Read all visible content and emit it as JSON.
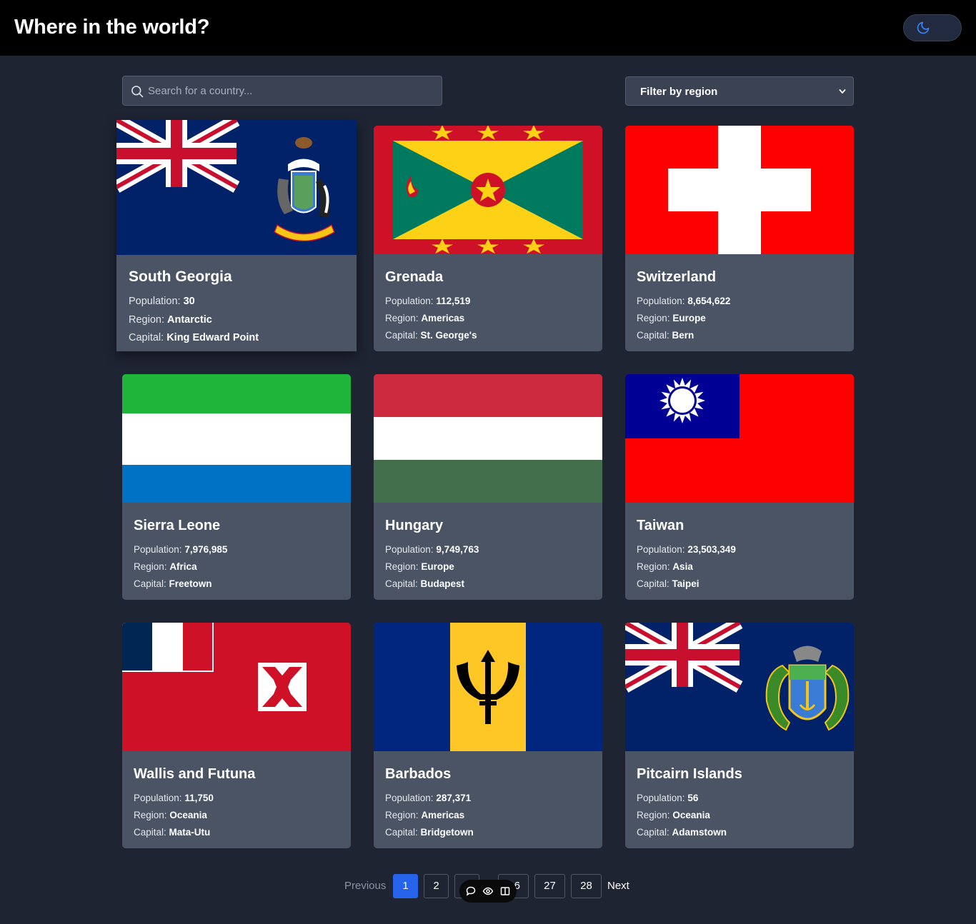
{
  "header": {
    "title": "Where in the world?",
    "theme_icon": "moon-icon"
  },
  "search": {
    "placeholder": "Search for a country..."
  },
  "filter": {
    "label": "Filter by region"
  },
  "labels": {
    "population": "Population:",
    "region": "Region:",
    "capital": "Capital:"
  },
  "countries": [
    {
      "name": "South Georgia",
      "population": "30",
      "region": "Antarctic",
      "capital": "King Edward Point"
    },
    {
      "name": "Grenada",
      "population": "112,519",
      "region": "Americas",
      "capital": "St. George's"
    },
    {
      "name": "Switzerland",
      "population": "8,654,622",
      "region": "Europe",
      "capital": "Bern"
    },
    {
      "name": "Sierra Leone",
      "population": "7,976,985",
      "region": "Africa",
      "capital": "Freetown"
    },
    {
      "name": "Hungary",
      "population": "9,749,763",
      "region": "Europe",
      "capital": "Budapest"
    },
    {
      "name": "Taiwan",
      "population": "23,503,349",
      "region": "Asia",
      "capital": "Taipei"
    },
    {
      "name": "Wallis and Futuna",
      "population": "11,750",
      "region": "Oceania",
      "capital": "Mata-Utu"
    },
    {
      "name": "Barbados",
      "population": "287,371",
      "region": "Americas",
      "capital": "Bridgetown"
    },
    {
      "name": "Pitcairn Islands",
      "population": "56",
      "region": "Oceania",
      "capital": "Adamstown"
    }
  ],
  "pagination": {
    "previous": "Previous",
    "next": "Next",
    "pages": [
      "1",
      "2",
      "3",
      "26",
      "27",
      "28"
    ],
    "visible_fragment": "6",
    "current": "1"
  },
  "colors": {
    "accent": "#2563eb",
    "background": "#1f2433",
    "card": "#4b5464",
    "header": "#000000"
  }
}
